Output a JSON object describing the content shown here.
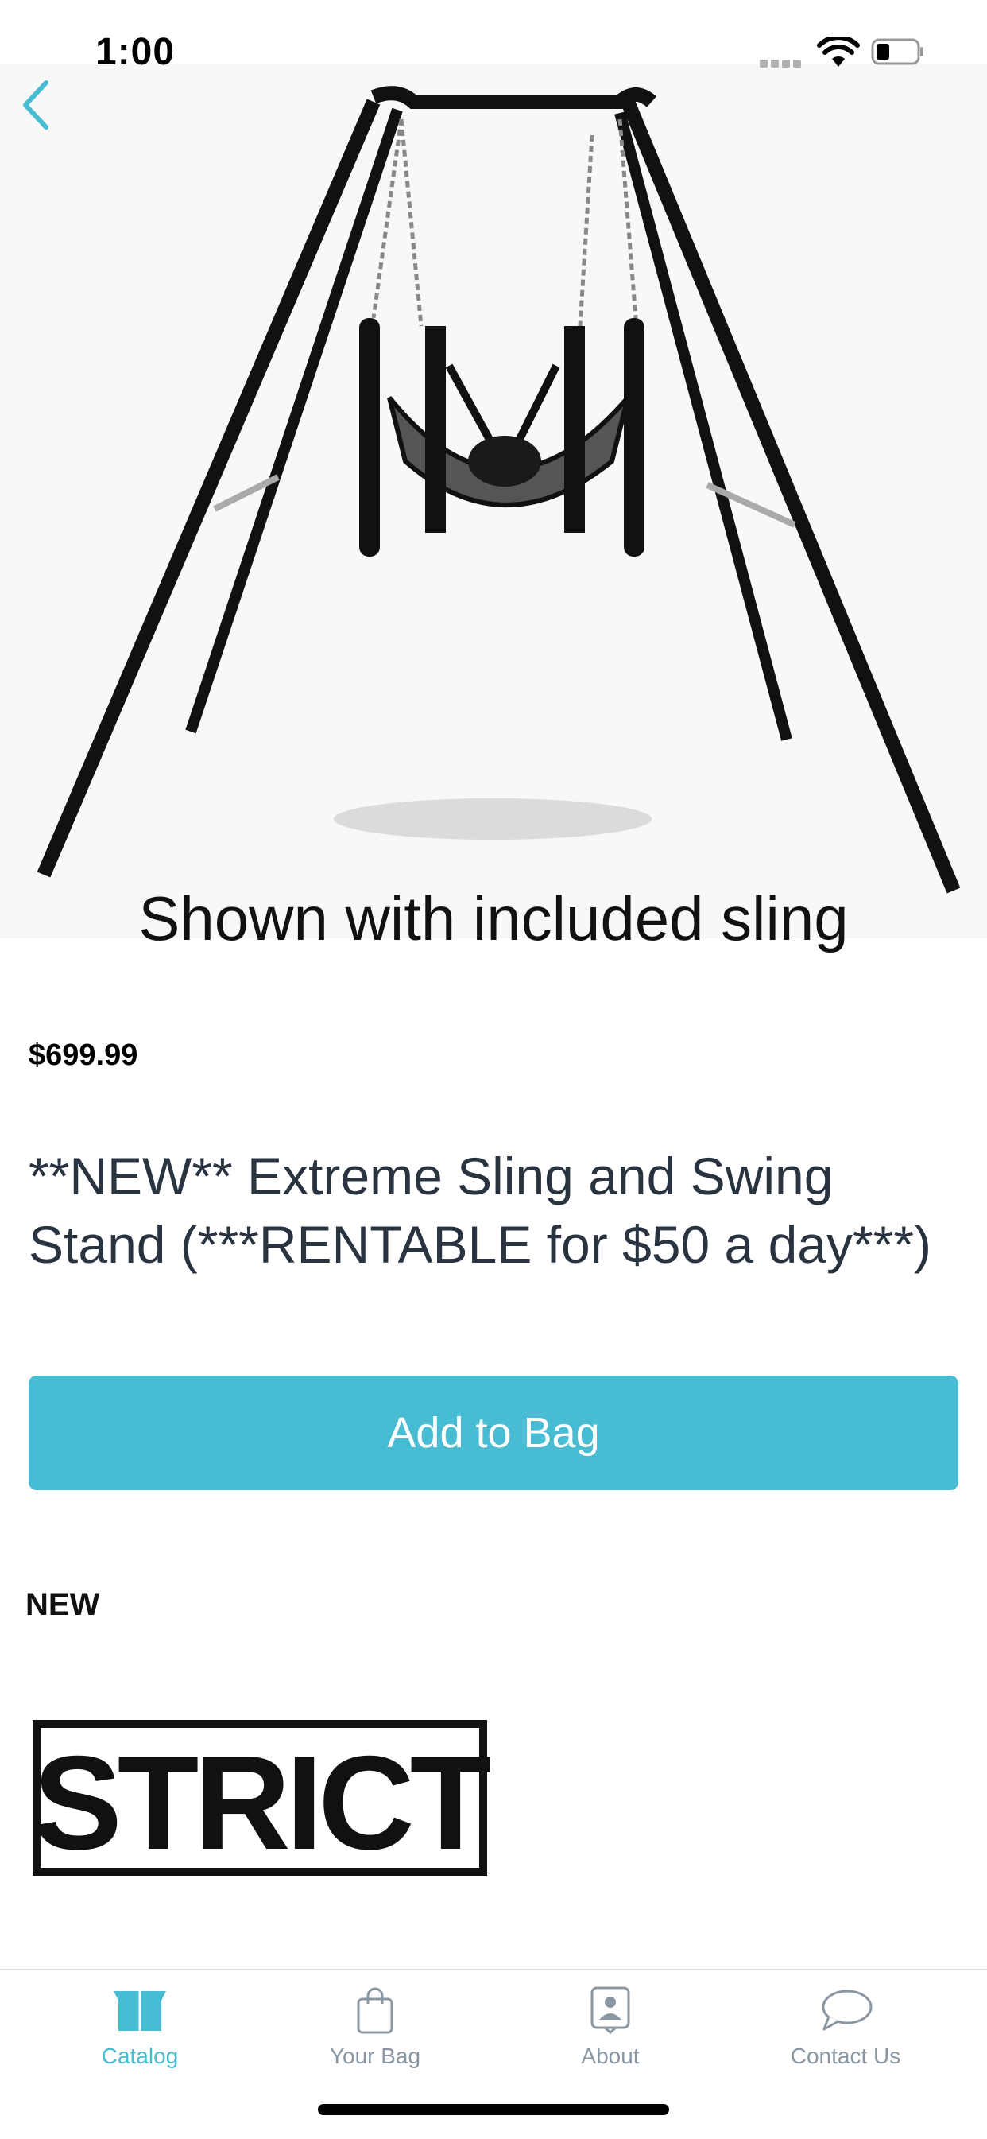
{
  "status_bar": {
    "time": "1:00"
  },
  "product": {
    "image_caption": "Shown with included sling",
    "price": "$699.99",
    "title": "**NEW** Extreme Sling and Swing Stand (***RENTABLE for $50 a day***)",
    "add_button_label": "Add to Bag"
  },
  "section": {
    "label": "NEW"
  },
  "brand": {
    "logo_text": "STRICT"
  },
  "tab_bar": {
    "tabs": [
      {
        "label": "Catalog",
        "icon": "box-icon",
        "active": true
      },
      {
        "label": "Your Bag",
        "icon": "bag-icon",
        "active": false
      },
      {
        "label": "About",
        "icon": "person-icon",
        "active": false
      },
      {
        "label": "Contact Us",
        "icon": "chat-bubble-icon",
        "active": false
      }
    ]
  },
  "colors": {
    "accent": "#47bcd2",
    "inactive_tab": "#8a97a3",
    "title_text": "#2a3340"
  }
}
